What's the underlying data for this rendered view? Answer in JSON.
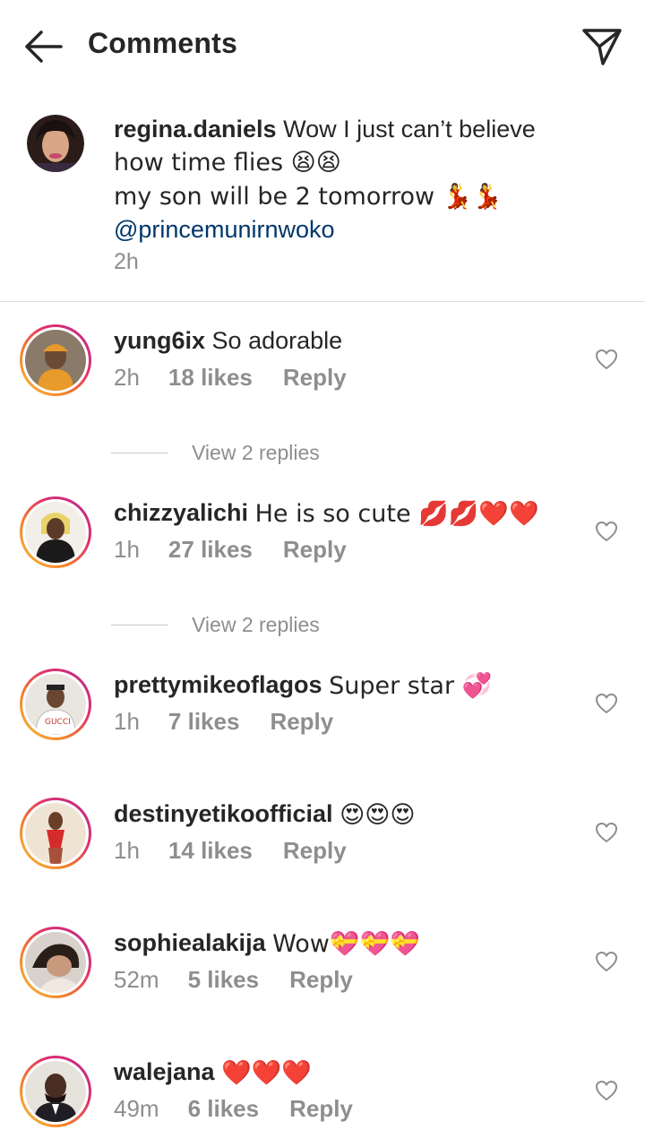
{
  "header": {
    "title": "Comments"
  },
  "caption": {
    "username": "regina.daniels",
    "text_line1": "Wow I just can’t believe",
    "text_line2": "how time flies 😫😫",
    "text_line3": " my son will be 2 tomorrow 💃💃",
    "mention": "@princemunirnwoko",
    "time": "2h"
  },
  "comments": [
    {
      "username": "yung6ix",
      "text": "So adorable",
      "time": "2h",
      "likes": "18 likes",
      "reply": "Reply",
      "view_replies": "View 2 replies"
    },
    {
      "username": "chizzyalichi",
      "text": "He is so cute 💋💋❤️❤️",
      "time": "1h",
      "likes": "27 likes",
      "reply": "Reply",
      "view_replies": "View 2 replies"
    },
    {
      "username": "prettymikeoflagos",
      "text": "Super star 💞",
      "time": "1h",
      "likes": "7 likes",
      "reply": "Reply"
    },
    {
      "username": "destinyetikoofficial",
      "text": "😍😍😍",
      "time": "1h",
      "likes": "14 likes",
      "reply": "Reply"
    },
    {
      "username": "sophiealakija",
      "text": "Wow💝💝💝",
      "time": "52m",
      "likes": "5 likes",
      "reply": "Reply"
    },
    {
      "username": "walejana",
      "text": "❤️❤️❤️",
      "time": "49m",
      "likes": "6 likes",
      "reply": "Reply"
    }
  ],
  "icons": {
    "back": "arrow-left-icon",
    "send": "paper-plane-icon",
    "like": "heart-outline-icon"
  },
  "colors": {
    "text": "#262626",
    "secondary": "#8e8e8e",
    "mention": "#00376b",
    "divider": "#dbdbdb"
  }
}
